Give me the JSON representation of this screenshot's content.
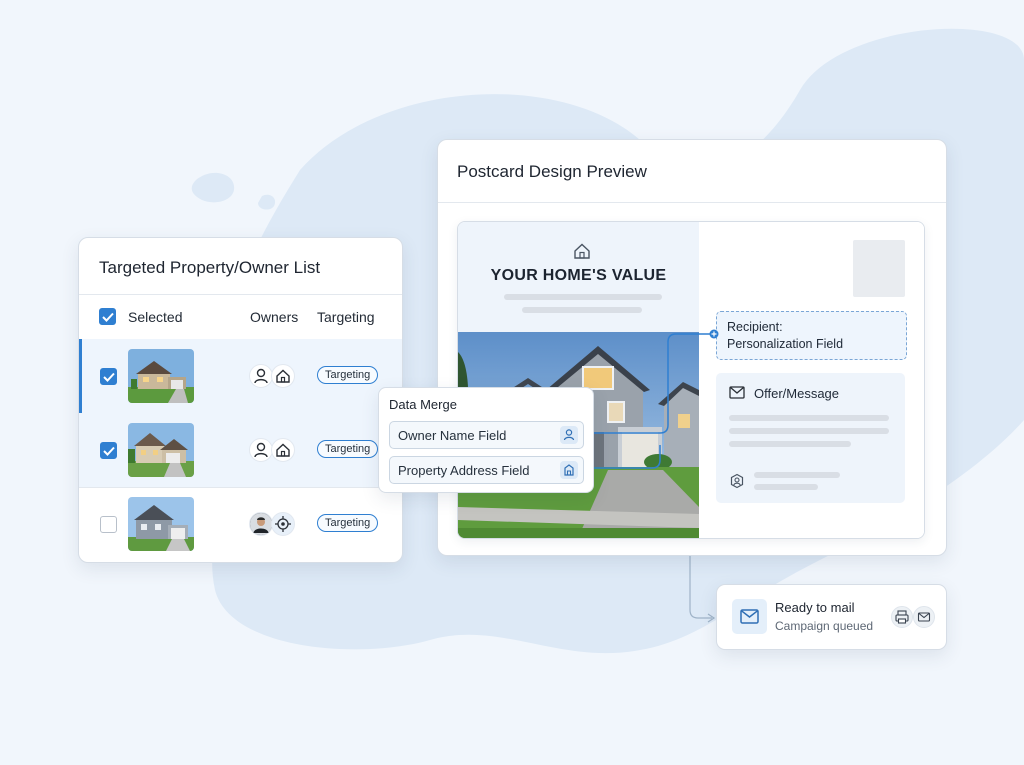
{
  "list": {
    "title": "Targeted Property/Owner List",
    "headers": {
      "selected": "Selected",
      "owners": "Owners",
      "targeting": "Targeting"
    },
    "rows": [
      {
        "selected": true,
        "image": "house-photo-1",
        "owner_icons": [
          "person-icon",
          "home-icon"
        ],
        "status": "Targeting"
      },
      {
        "selected": true,
        "image": "house-photo-2",
        "owner_icons": [
          "person-icon",
          "home-icon"
        ],
        "status": "Targeting"
      },
      {
        "selected": false,
        "image": "house-photo-3",
        "owner_icons": [
          "owner-avatar",
          "target-icon"
        ],
        "status": "Targeting"
      }
    ]
  },
  "preview": {
    "title": "Postcard Design Preview",
    "headline": "YOUR HOME'S VALUE",
    "recipient_line1": "Recipient:",
    "recipient_line2": "Personalization Field",
    "offer_label": "Offer/Message"
  },
  "merge": {
    "title": "Data Merge",
    "fields": [
      {
        "label": "Owner Name Field",
        "icon": "person-icon"
      },
      {
        "label": "Property Address Field",
        "icon": "building-icon"
      }
    ]
  },
  "status": {
    "title": "Ready to mail",
    "subtitle": "Campaign queued",
    "icons": [
      "printer-icon",
      "mail-icon"
    ]
  },
  "colors": {
    "accent": "#2f7fd1",
    "background": "#f1f6fc",
    "blob": "#dde9f6"
  }
}
